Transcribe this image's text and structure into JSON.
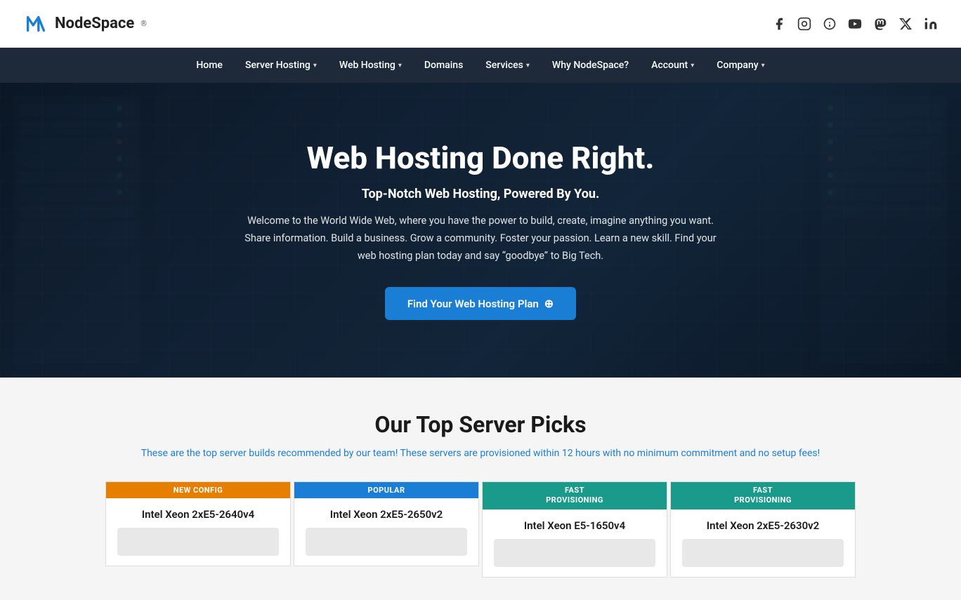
{
  "topbar": {
    "logo_text": "NodeSpace",
    "social_icons": [
      "facebook",
      "instagram",
      "threads",
      "youtube",
      "mastodon",
      "x-twitter",
      "linkedin"
    ]
  },
  "nav": {
    "items": [
      {
        "label": "Home",
        "has_dropdown": false
      },
      {
        "label": "Server Hosting",
        "has_dropdown": true
      },
      {
        "label": "Web Hosting",
        "has_dropdown": true
      },
      {
        "label": "Domains",
        "has_dropdown": false
      },
      {
        "label": "Services",
        "has_dropdown": true
      },
      {
        "label": "Why NodeSpace?",
        "has_dropdown": false
      },
      {
        "label": "Account",
        "has_dropdown": true
      },
      {
        "label": "Company",
        "has_dropdown": true
      }
    ]
  },
  "hero": {
    "title": "Web Hosting Done Right.",
    "subtitle": "Top-Notch Web Hosting, Powered By You.",
    "description": "Welcome to the World Wide Web, where you have the power to build, create, imagine anything you want. Share information. Build a business. Grow a community. Foster your passion. Learn a new skill. Find your web hosting plan today and say “goodbye” to Big Tech.",
    "cta_label": "Find Your Web Hosting Plan"
  },
  "server_picks": {
    "title": "Our Top Server Picks",
    "subtitle_prefix": "These are the top server builds recommended by our team! These servers are provisioned within ",
    "subtitle_highlight": "12 hours",
    "subtitle_suffix": " with no minimum commitment and no setup fees!",
    "cards": [
      {
        "badge": "NEW CONFIG",
        "badge_type": "orange",
        "cpu": "Intel Xeon 2xE5-2640v4"
      },
      {
        "badge": "POPULAR",
        "badge_type": "blue",
        "cpu": "Intel Xeon 2xE5-2650v2"
      },
      {
        "badge": "FAST\nPROVISIONING",
        "badge_type": "teal",
        "cpu": "Intel Xeon E5-1650v4"
      },
      {
        "badge": "FAST\nPROVISIONING",
        "badge_type": "teal",
        "cpu": "Intel Xeon 2xE5-2630v2"
      }
    ]
  }
}
